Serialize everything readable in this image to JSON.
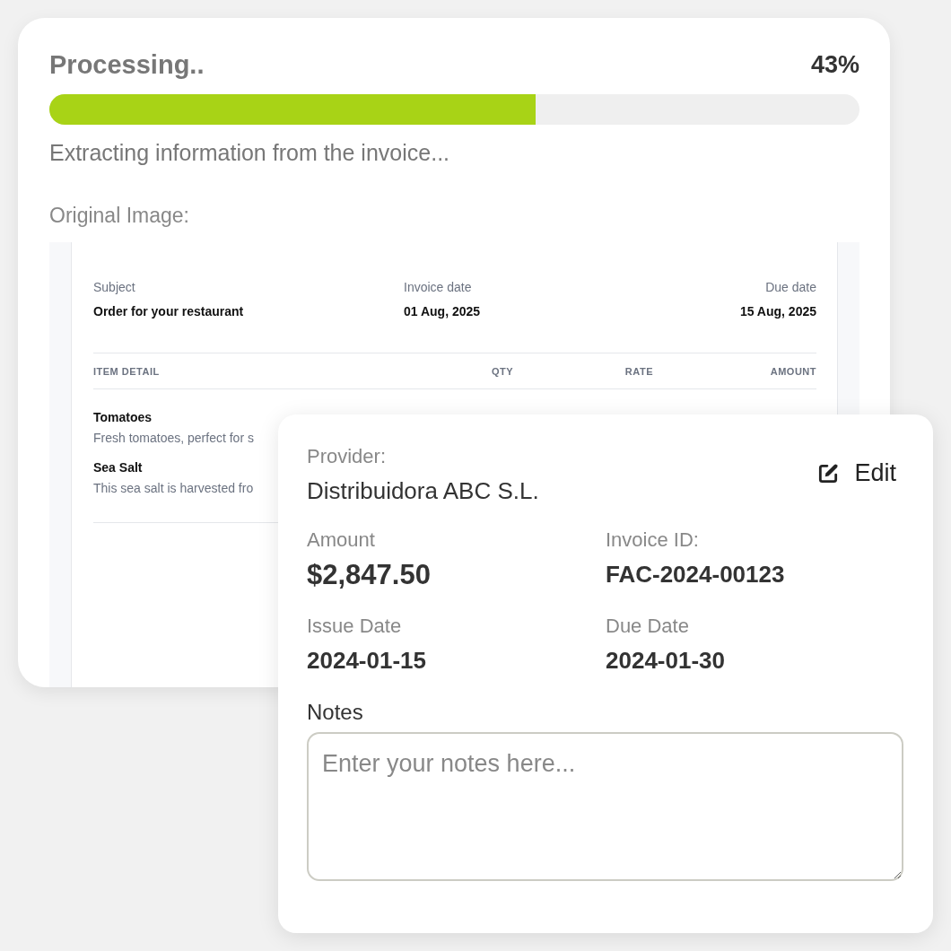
{
  "progress": {
    "title": "Processing..",
    "percent": "43%",
    "level": 0.6,
    "status": "Extracting information from the invoice..."
  },
  "original_image": {
    "label": "Original Image:",
    "fields": [
      {
        "label": "Subject",
        "value": "Order for your restaurant"
      },
      {
        "label": "Invoice date",
        "value": "01 Aug, 2025"
      },
      {
        "label": "Due date",
        "value": "15 Aug, 2025"
      }
    ],
    "columns": [
      "ITEM DETAIL",
      "QTY",
      "RATE",
      "AMOUNT"
    ],
    "items": [
      {
        "name": "Tomatoes",
        "description": "Fresh tomatoes, perfect for s"
      },
      {
        "name": "Sea Salt",
        "description": "This sea salt is harvested fro"
      }
    ]
  },
  "details": {
    "edit_button": "Edit",
    "fields": [
      {
        "kind": "provider",
        "label": "Provider:",
        "value": "Distribuidora ABC S.L."
      },
      {
        "kind": "amount",
        "label": "Amount",
        "value": "$2,847.50"
      },
      {
        "kind": "plain",
        "label": "Invoice ID:",
        "value": "FAC-2024-00123"
      },
      {
        "kind": "plain",
        "label": "Issue Date",
        "value": "2024-01-15"
      },
      {
        "kind": "plain",
        "label": "Due Date",
        "value": "2024-01-30"
      }
    ],
    "notes": {
      "label": "Notes",
      "placeholder": "Enter your notes here..."
    }
  }
}
